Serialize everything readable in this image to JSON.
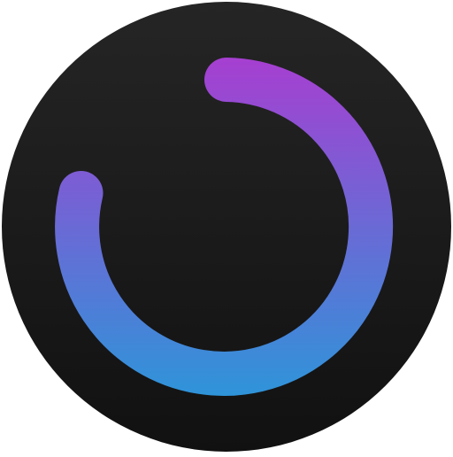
{
  "app_icon": {
    "name": "progress-ring-app-icon",
    "background": {
      "shape": "circle",
      "gradient_top": "#252525",
      "gradient_bottom": "#111111"
    },
    "progress_ring": {
      "shape": "open-arc",
      "start": "top",
      "end": "left",
      "direction": "clockwise",
      "gradient_top": "#a63fd1",
      "gradient_bottom": "#2f94d9",
      "line_cap": "round"
    }
  }
}
